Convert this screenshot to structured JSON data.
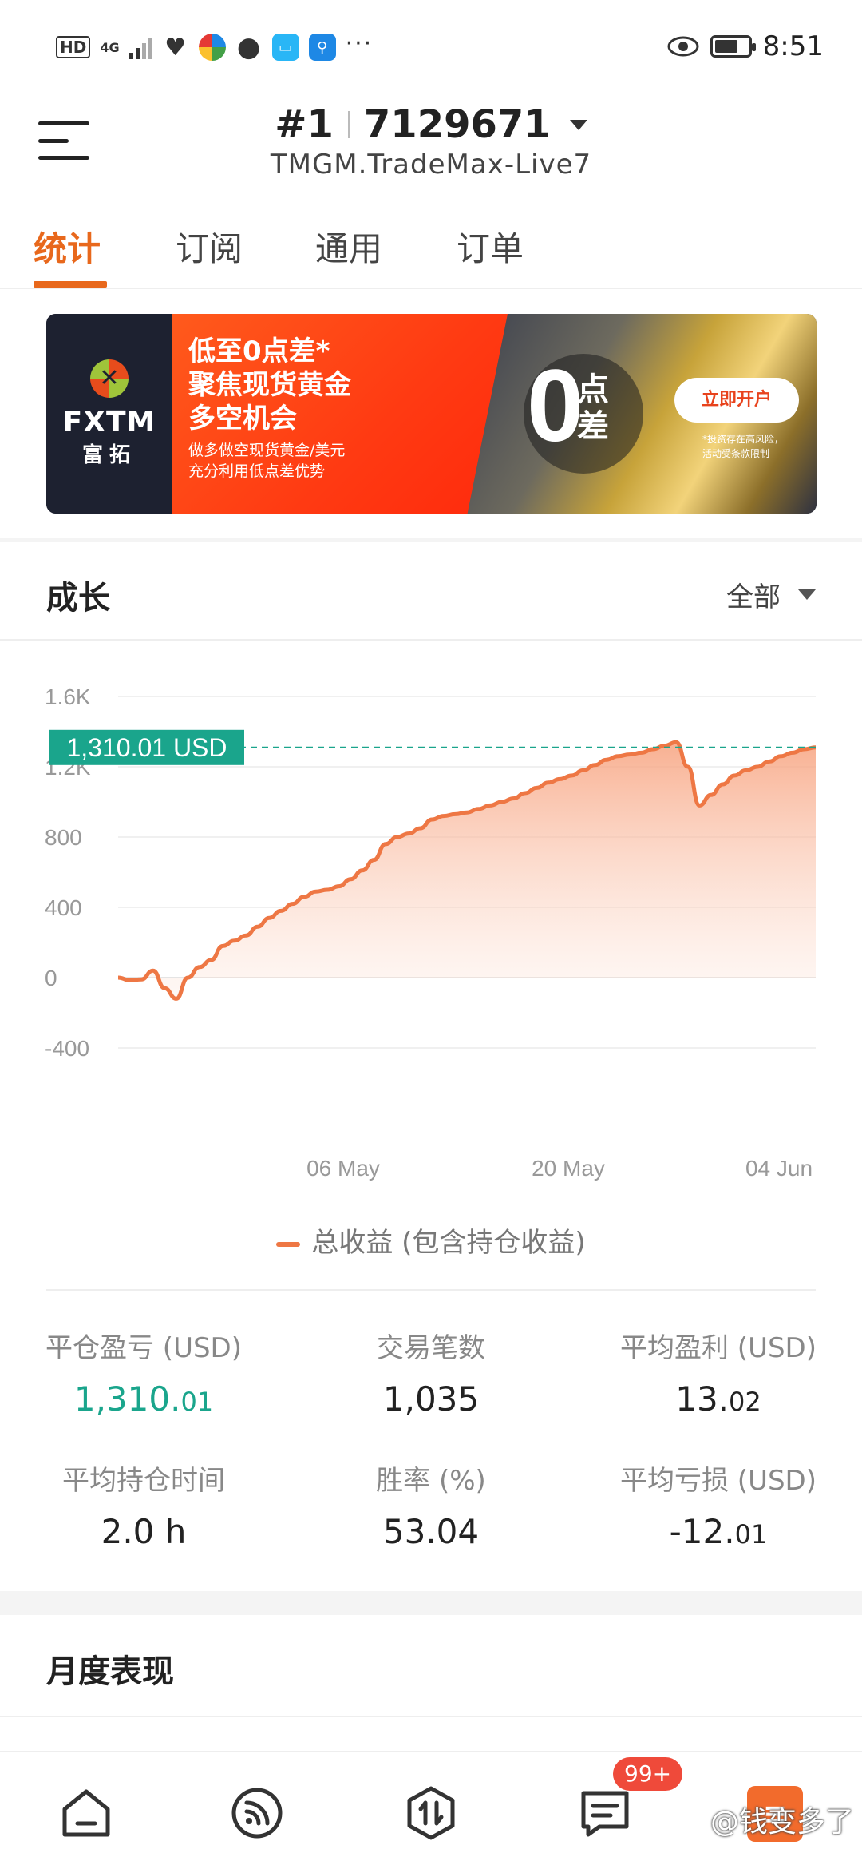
{
  "status_bar": {
    "time": "8:51",
    "network": "4G",
    "hd": "HD",
    "more": "···",
    "battery_level": 0.7
  },
  "header": {
    "account_prefix": "#1",
    "account_number": "7129671",
    "server": "TMGM.TradeMax-Live7"
  },
  "tabs": [
    "统计",
    "订阅",
    "通用",
    "订单"
  ],
  "banner": {
    "brand": "FXTM",
    "brand_cn": "富拓",
    "headline": [
      "低至0点差*",
      "聚焦现货黄金",
      "多空机会"
    ],
    "sub": [
      "做多做空现货黄金/美元",
      "充分利用低点差优势"
    ],
    "zero": "0",
    "zero_label": "点差",
    "cta": "立即开户",
    "note": [
      "*投资存在高风险，",
      "活动受条款限制"
    ]
  },
  "growth": {
    "title": "成长",
    "filter": "全部",
    "current_label": "1,310.01 USD",
    "legend": "总收益 (包含持仓收益)"
  },
  "chart_data": {
    "type": "area",
    "y_ticks": [
      "1.6K",
      "1.2K",
      "800",
      "400",
      "0",
      "-400"
    ],
    "x_ticks": [
      "06 May",
      "20 May",
      "04 Jun"
    ],
    "ylim": [
      -400,
      1600
    ],
    "series": [
      {
        "name": "总收益 (包含持仓收益)",
        "color": "#ee7744",
        "values": [
          0,
          -15,
          -10,
          40,
          -60,
          -120,
          0,
          60,
          100,
          180,
          210,
          240,
          290,
          340,
          380,
          420,
          460,
          490,
          500,
          520,
          560,
          610,
          670,
          760,
          800,
          820,
          850,
          900,
          920,
          930,
          940,
          960,
          980,
          1000,
          1020,
          1050,
          1080,
          1110,
          1130,
          1150,
          1180,
          1210,
          1240,
          1260,
          1270,
          1280,
          1300,
          1320,
          1340,
          1200,
          980,
          1040,
          1100,
          1150,
          1180,
          1200,
          1230,
          1260,
          1280,
          1300,
          1310
        ]
      }
    ],
    "current_value": 1310.01
  },
  "stats": [
    {
      "label": "平仓盈亏 (USD)",
      "value_int": "1,310.",
      "value_dec": "01",
      "color": "green"
    },
    {
      "label": "交易笔数",
      "value_int": "1,035",
      "value_dec": ""
    },
    {
      "label": "平均盈利 (USD)",
      "value_int": "13.",
      "value_dec": "02"
    },
    {
      "label": "平均持仓时间",
      "value_int": "2.0 h",
      "value_dec": ""
    },
    {
      "label": "胜率 (%)",
      "value_int": "53.04",
      "value_dec": ""
    },
    {
      "label": "平均亏损 (USD)",
      "value_int": "-12.",
      "value_dec": "01"
    }
  ],
  "monthly": {
    "title": "月度表现"
  },
  "bottom_nav": {
    "badge": "99+",
    "watermark": "@钱变多了"
  }
}
